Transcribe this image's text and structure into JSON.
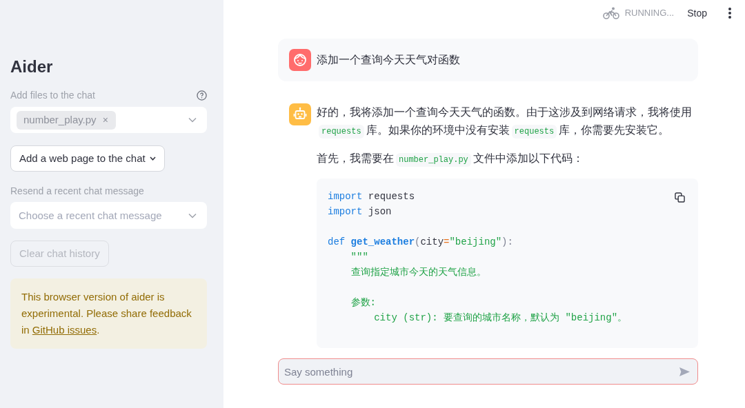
{
  "sidebar": {
    "title": "Aider",
    "file_picker": {
      "label": "Add files to the chat",
      "disabled": true,
      "chips": [
        {
          "text": "number_play.py",
          "remove": "×"
        }
      ]
    },
    "web_page_button": {
      "label": "Add a web page to the chat"
    },
    "recent_message_picker": {
      "label": "Resend a recent chat message",
      "placeholder": "Choose a recent chat message"
    },
    "clear_button": {
      "label": "Clear chat history",
      "disabled": true
    },
    "notice": {
      "text": "This browser version of aider is experimental. Please share feedback in ",
      "link": "GitHub issues",
      "end": "."
    }
  },
  "toolbar": {
    "status": "RUNNING...",
    "stop": "Stop"
  },
  "messages": [
    {
      "kind": "user",
      "blocks": [
        {
          "kind": "paragraph",
          "segments": [
            {
              "kind": "text",
              "text": "添加一个查询今天天气对函数"
            }
          ]
        }
      ]
    },
    {
      "kind": "assistant",
      "blocks": [
        {
          "kind": "paragraph",
          "segments": [
            {
              "kind": "text",
              "text": "好的，我将添加一个查询今天天气的函数。由于这涉及到网络请求，我将使用"
            },
            {
              "kind": "code",
              "text": "requests"
            },
            {
              "kind": "text",
              "text": "库。如果你的环境中没有安装"
            },
            {
              "kind": "code",
              "text": "requests"
            },
            {
              "kind": "text",
              "text": "库，你需要先安装它。"
            }
          ]
        },
        {
          "kind": "paragraph",
          "segments": [
            {
              "kind": "text",
              "text": "首先，我需要在"
            },
            {
              "kind": "code",
              "text": "number_play.py"
            },
            {
              "kind": "text",
              "text": "文件中添加以下代码："
            }
          ]
        },
        {
          "kind": "code_block",
          "groups": [
            [
              [
                {
                  "kind": "keyword",
                  "text": "import"
                },
                {
                  "kind": "plain",
                  "text": " requests"
                }
              ],
              [
                {
                  "kind": "keyword",
                  "text": "import"
                },
                {
                  "kind": "plain",
                  "text": " json"
                }
              ]
            ],
            [
              [
                {
                  "kind": "keyword",
                  "text": "def"
                },
                {
                  "kind": "function",
                  "text": " get_weather"
                },
                {
                  "kind": "punct",
                  "text": "("
                },
                {
                  "kind": "plain",
                  "text": "city"
                },
                {
                  "kind": "operator",
                  "text": "="
                },
                {
                  "kind": "string",
                  "text": "\"beijing\""
                },
                {
                  "kind": "punct",
                  "text": "):"
                }
              ],
              [
                {
                  "kind": "string",
                  "text": "    \"\"\""
                }
              ],
              [
                {
                  "kind": "string",
                  "text": "    查询指定城市今天的天气信息。"
                }
              ]
            ],
            [
              [
                {
                  "kind": "string",
                  "text": "    参数:"
                }
              ],
              [
                {
                  "kind": "string",
                  "text": "        city (str): 要查询的城市名称，默认为 \"beijing\"。"
                }
              ]
            ]
          ]
        }
      ]
    }
  ],
  "chat_input": {
    "placeholder": "Say something",
    "focused": true
  }
}
